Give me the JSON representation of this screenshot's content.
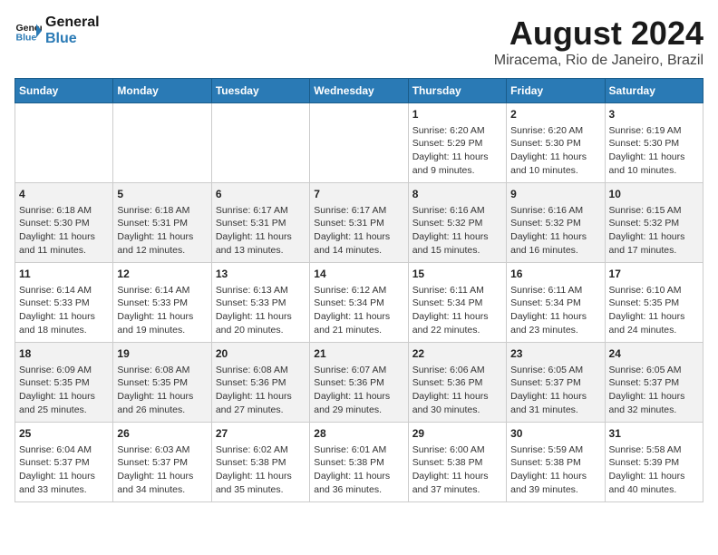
{
  "header": {
    "logo_line1": "General",
    "logo_line2": "Blue",
    "month_title": "August 2024",
    "location": "Miracema, Rio de Janeiro, Brazil"
  },
  "weekdays": [
    "Sunday",
    "Monday",
    "Tuesday",
    "Wednesday",
    "Thursday",
    "Friday",
    "Saturday"
  ],
  "weeks": [
    [
      {
        "day": "",
        "info": ""
      },
      {
        "day": "",
        "info": ""
      },
      {
        "day": "",
        "info": ""
      },
      {
        "day": "",
        "info": ""
      },
      {
        "day": "1",
        "info": "Sunrise: 6:20 AM\nSunset: 5:29 PM\nDaylight: 11 hours\nand 9 minutes."
      },
      {
        "day": "2",
        "info": "Sunrise: 6:20 AM\nSunset: 5:30 PM\nDaylight: 11 hours\nand 10 minutes."
      },
      {
        "day": "3",
        "info": "Sunrise: 6:19 AM\nSunset: 5:30 PM\nDaylight: 11 hours\nand 10 minutes."
      }
    ],
    [
      {
        "day": "4",
        "info": "Sunrise: 6:18 AM\nSunset: 5:30 PM\nDaylight: 11 hours\nand 11 minutes."
      },
      {
        "day": "5",
        "info": "Sunrise: 6:18 AM\nSunset: 5:31 PM\nDaylight: 11 hours\nand 12 minutes."
      },
      {
        "day": "6",
        "info": "Sunrise: 6:17 AM\nSunset: 5:31 PM\nDaylight: 11 hours\nand 13 minutes."
      },
      {
        "day": "7",
        "info": "Sunrise: 6:17 AM\nSunset: 5:31 PM\nDaylight: 11 hours\nand 14 minutes."
      },
      {
        "day": "8",
        "info": "Sunrise: 6:16 AM\nSunset: 5:32 PM\nDaylight: 11 hours\nand 15 minutes."
      },
      {
        "day": "9",
        "info": "Sunrise: 6:16 AM\nSunset: 5:32 PM\nDaylight: 11 hours\nand 16 minutes."
      },
      {
        "day": "10",
        "info": "Sunrise: 6:15 AM\nSunset: 5:32 PM\nDaylight: 11 hours\nand 17 minutes."
      }
    ],
    [
      {
        "day": "11",
        "info": "Sunrise: 6:14 AM\nSunset: 5:33 PM\nDaylight: 11 hours\nand 18 minutes."
      },
      {
        "day": "12",
        "info": "Sunrise: 6:14 AM\nSunset: 5:33 PM\nDaylight: 11 hours\nand 19 minutes."
      },
      {
        "day": "13",
        "info": "Sunrise: 6:13 AM\nSunset: 5:33 PM\nDaylight: 11 hours\nand 20 minutes."
      },
      {
        "day": "14",
        "info": "Sunrise: 6:12 AM\nSunset: 5:34 PM\nDaylight: 11 hours\nand 21 minutes."
      },
      {
        "day": "15",
        "info": "Sunrise: 6:11 AM\nSunset: 5:34 PM\nDaylight: 11 hours\nand 22 minutes."
      },
      {
        "day": "16",
        "info": "Sunrise: 6:11 AM\nSunset: 5:34 PM\nDaylight: 11 hours\nand 23 minutes."
      },
      {
        "day": "17",
        "info": "Sunrise: 6:10 AM\nSunset: 5:35 PM\nDaylight: 11 hours\nand 24 minutes."
      }
    ],
    [
      {
        "day": "18",
        "info": "Sunrise: 6:09 AM\nSunset: 5:35 PM\nDaylight: 11 hours\nand 25 minutes."
      },
      {
        "day": "19",
        "info": "Sunrise: 6:08 AM\nSunset: 5:35 PM\nDaylight: 11 hours\nand 26 minutes."
      },
      {
        "day": "20",
        "info": "Sunrise: 6:08 AM\nSunset: 5:36 PM\nDaylight: 11 hours\nand 27 minutes."
      },
      {
        "day": "21",
        "info": "Sunrise: 6:07 AM\nSunset: 5:36 PM\nDaylight: 11 hours\nand 29 minutes."
      },
      {
        "day": "22",
        "info": "Sunrise: 6:06 AM\nSunset: 5:36 PM\nDaylight: 11 hours\nand 30 minutes."
      },
      {
        "day": "23",
        "info": "Sunrise: 6:05 AM\nSunset: 5:37 PM\nDaylight: 11 hours\nand 31 minutes."
      },
      {
        "day": "24",
        "info": "Sunrise: 6:05 AM\nSunset: 5:37 PM\nDaylight: 11 hours\nand 32 minutes."
      }
    ],
    [
      {
        "day": "25",
        "info": "Sunrise: 6:04 AM\nSunset: 5:37 PM\nDaylight: 11 hours\nand 33 minutes."
      },
      {
        "day": "26",
        "info": "Sunrise: 6:03 AM\nSunset: 5:37 PM\nDaylight: 11 hours\nand 34 minutes."
      },
      {
        "day": "27",
        "info": "Sunrise: 6:02 AM\nSunset: 5:38 PM\nDaylight: 11 hours\nand 35 minutes."
      },
      {
        "day": "28",
        "info": "Sunrise: 6:01 AM\nSunset: 5:38 PM\nDaylight: 11 hours\nand 36 minutes."
      },
      {
        "day": "29",
        "info": "Sunrise: 6:00 AM\nSunset: 5:38 PM\nDaylight: 11 hours\nand 37 minutes."
      },
      {
        "day": "30",
        "info": "Sunrise: 5:59 AM\nSunset: 5:38 PM\nDaylight: 11 hours\nand 39 minutes."
      },
      {
        "day": "31",
        "info": "Sunrise: 5:58 AM\nSunset: 5:39 PM\nDaylight: 11 hours\nand 40 minutes."
      }
    ]
  ]
}
